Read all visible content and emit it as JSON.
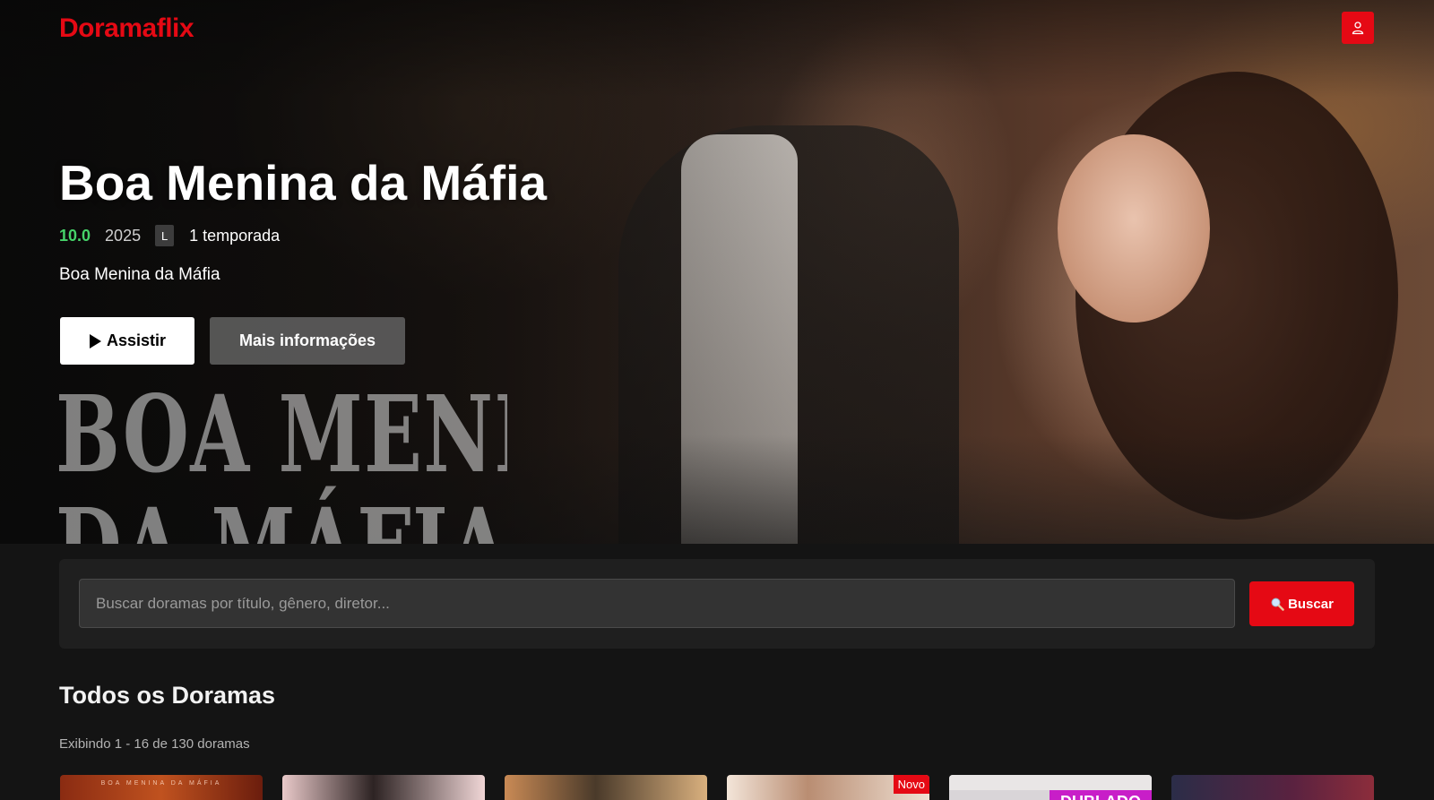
{
  "header": {
    "logo": "Doramaflix",
    "profile_icon": "user-icon"
  },
  "hero": {
    "title": "Boa Menina da Máfia",
    "rating": "10.0",
    "year": "2025",
    "age_rating": "L",
    "seasons": "1 temporada",
    "description": "Boa Menina da Máfia",
    "art_title_line1": "BOA MENINA",
    "art_title_line2": "DA MÁFIA",
    "play_label": "Assistir",
    "info_label": "Mais informações"
  },
  "search": {
    "placeholder": "Buscar doramas por título, gênero, diretor...",
    "button_label": "Buscar"
  },
  "listing": {
    "title": "Todos os Doramas",
    "count_text": "Exibindo 1 - 16 de 130 doramas",
    "cards": [
      {
        "badge": "",
        "caption": "BOA MENINA DA MÁFIA",
        "bg": "linear-gradient(90deg,#8a2b12,#c0521f 50%,#6b1d0d)"
      },
      {
        "badge": "",
        "caption": "",
        "bg": "linear-gradient(90deg,#e9c9c9,#2d2323 45%,#f0d6d6)"
      },
      {
        "badge": "",
        "caption": "",
        "bg": "linear-gradient(90deg,#c98a55,#4a3a2a 45%,#d9b07e)"
      },
      {
        "badge": "Novo",
        "caption": "",
        "bg": "linear-gradient(90deg,#f3e5d9,#b98d72 40%,#efe0d3)"
      },
      {
        "badge": "",
        "caption": "",
        "dub": "DUBLADO",
        "bg": "#d9d5d8"
      },
      {
        "badge": "",
        "caption": "",
        "bg": "linear-gradient(90deg,#2b2d48,#5a2240 60%,#8c2d3b)"
      }
    ]
  }
}
